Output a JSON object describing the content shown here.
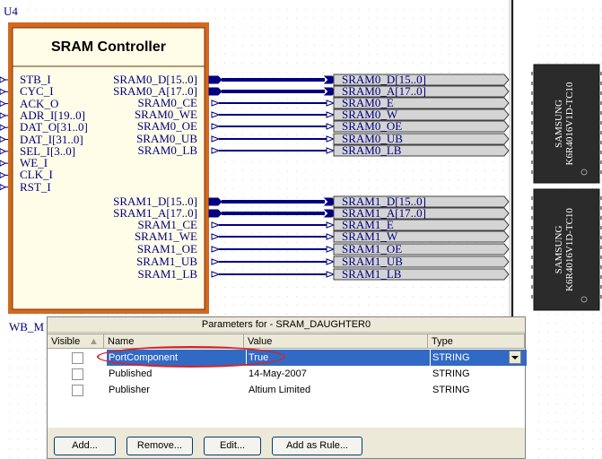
{
  "schematic": {
    "designator": "U4",
    "component_title": "SRAM Controller",
    "hidden_label": "WB_M",
    "left_pins": [
      "STB_I",
      "CYC_I",
      "ACK_O",
      "ADR_I[19..0]",
      "DAT_O[31..0]",
      "DAT_I[31..0]",
      "SEL_I[3..0]",
      "WE_I",
      "CLK_I",
      "RST_I"
    ],
    "right_pins": [
      "SRAM0_D[15..0]",
      "SRAM0_A[17..0]",
      "SRAM0_CE",
      "SRAM0_WE",
      "SRAM0_OE",
      "SRAM0_UB",
      "SRAM0_LB",
      "SRAM1_D[15..0]",
      "SRAM1_A[17..0]",
      "SRAM1_CE",
      "SRAM1_WE",
      "SRAM1_OE",
      "SRAM1_UB",
      "SRAM1_LB"
    ],
    "ports": [
      "SRAM0_D[15..0]",
      "SRAM0_A[17..0]",
      "SRAM0_E",
      "SRAM0_W",
      "SRAM0_OE",
      "SRAM0_UB",
      "SRAM0_LB",
      "SRAM1_D[15..0]",
      "SRAM1_A[17..0]",
      "SRAM1_E",
      "SRAM1_W",
      "SRAM1_OE",
      "SRAM1_UB",
      "SRAM1_LB"
    ],
    "chips": [
      {
        "brand": "SAMSUNG",
        "part": "K6R4016V1D-TC10"
      },
      {
        "brand": "SAMSUNG",
        "part": "K6R4016V1D-TC10"
      }
    ],
    "colors": {
      "component_fill": "#d2691e",
      "component_border": "#8b3a00",
      "wire": "#000080",
      "bus": "#000080",
      "port_fill": "#d4d4d4",
      "chip_fill": "#2b2b2b",
      "pin_text": "#000080"
    }
  },
  "dialog": {
    "title": "Parameters for  - SRAM_DAUGHTER0",
    "columns": [
      "Visible",
      "Name",
      "Value",
      "Type"
    ],
    "rows": [
      {
        "visible": false,
        "name": "PortComponent",
        "value": "True",
        "type": "STRING",
        "selected": true
      },
      {
        "visible": false,
        "name": "Published",
        "value": "14-May-2007",
        "type": "STRING",
        "selected": false
      },
      {
        "visible": false,
        "name": "Publisher",
        "value": "Altium Limited",
        "type": "STRING",
        "selected": false
      }
    ],
    "buttons": [
      "Add...",
      "Remove...",
      "Edit...",
      "Add as Rule..."
    ],
    "selected_color": "#316ac5",
    "highlight_color": "#e02020"
  }
}
